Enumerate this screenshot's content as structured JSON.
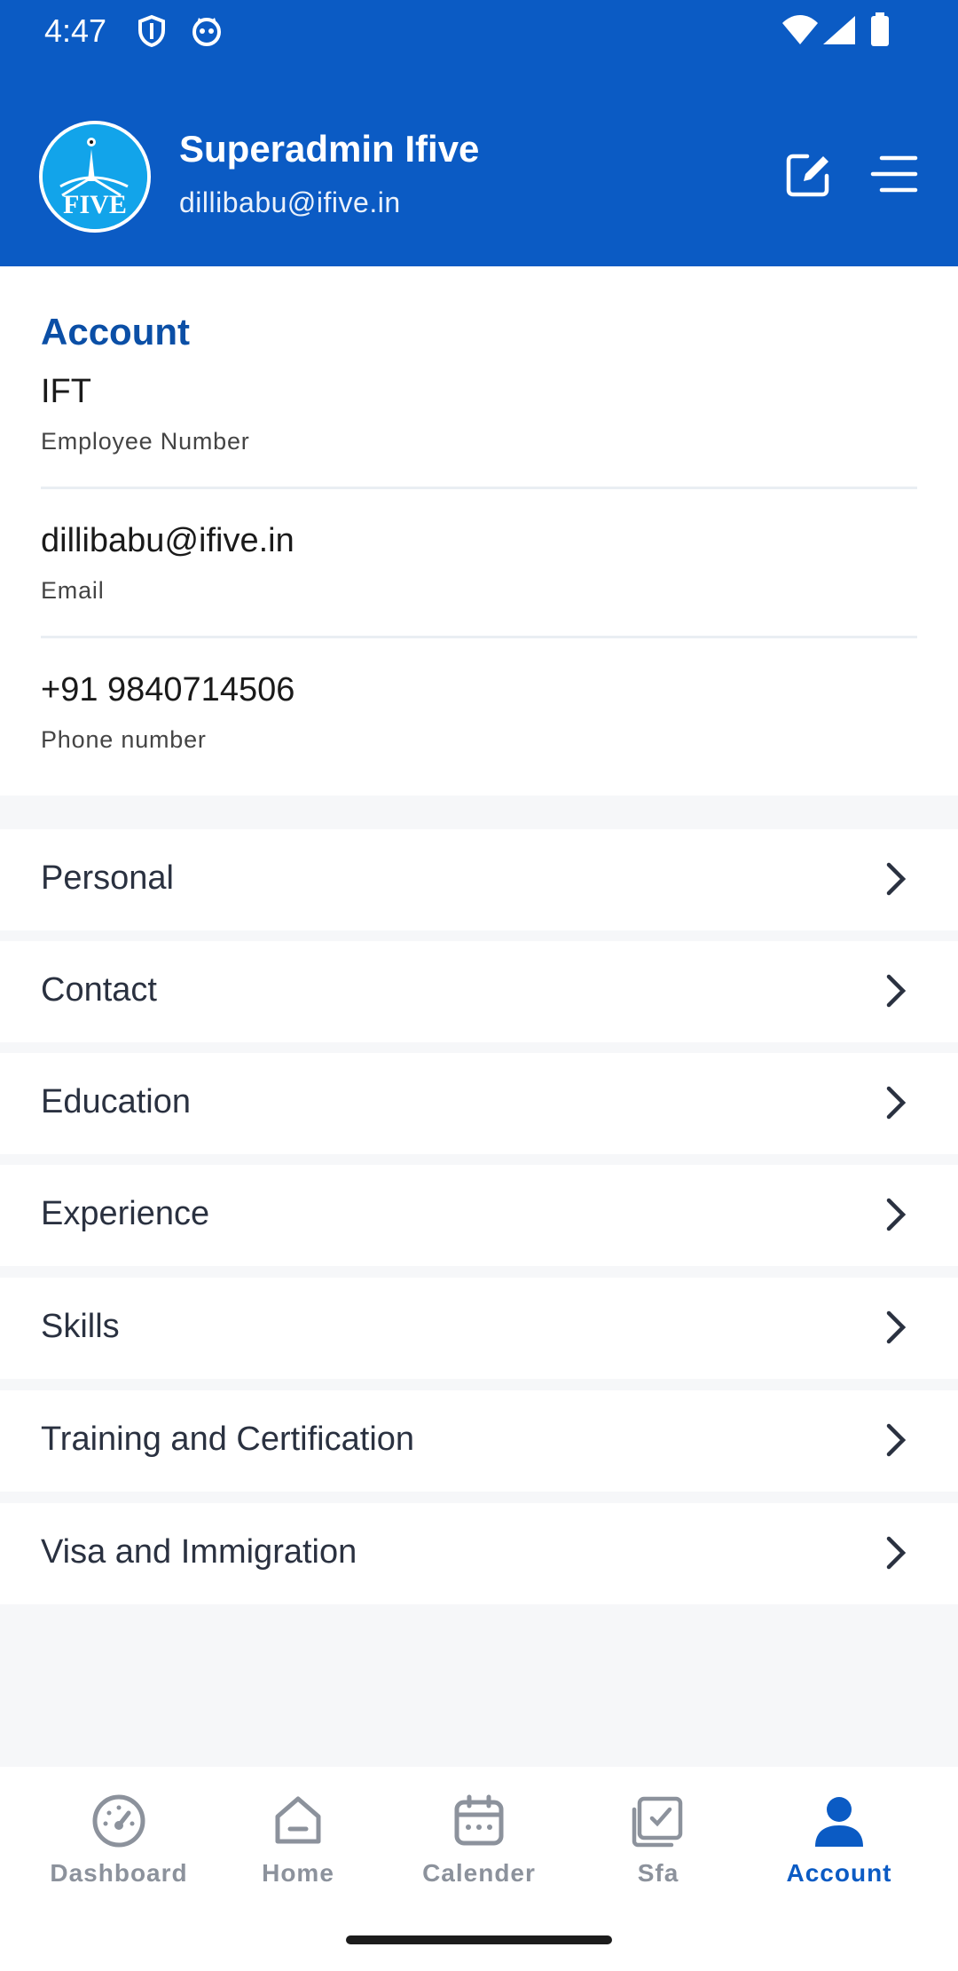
{
  "status_bar": {
    "time": "4:47",
    "icons": [
      "shield-icon",
      "cat-icon",
      "wifi-icon",
      "signal-icon",
      "battery-icon"
    ]
  },
  "header": {
    "logo_text": "FIVE",
    "name": "Superadmin Ifive",
    "email": "dillibabu@ifive.in",
    "icons": [
      "edit-icon",
      "menu-icon"
    ]
  },
  "account": {
    "title": "Account",
    "fields": [
      {
        "value": "IFT",
        "label": "Employee Number"
      },
      {
        "value": "dillibabu@ifive.in",
        "label": "Email"
      },
      {
        "value": "+91 9840714506",
        "label": "Phone number"
      }
    ]
  },
  "menu": {
    "items": [
      {
        "label": "Personal"
      },
      {
        "label": "Contact"
      },
      {
        "label": "Education"
      },
      {
        "label": "Experience"
      },
      {
        "label": "Skills"
      },
      {
        "label": "Training and Certification"
      },
      {
        "label": "Visa and Immigration"
      }
    ]
  },
  "bottom_nav": {
    "items": [
      {
        "label": "Dashboard",
        "icon": "dashboard-icon"
      },
      {
        "label": "Home",
        "icon": "home-icon"
      },
      {
        "label": "Calender",
        "icon": "calendar-icon"
      },
      {
        "label": "Sfa",
        "icon": "sfa-icon"
      },
      {
        "label": "Account",
        "icon": "account-icon"
      }
    ],
    "active": "Account"
  },
  "colors": {
    "primary": "#0b5bc4",
    "account_title": "#0b4fa6",
    "background": "#f6f7f9",
    "nav_inactive": "#8c929c"
  }
}
